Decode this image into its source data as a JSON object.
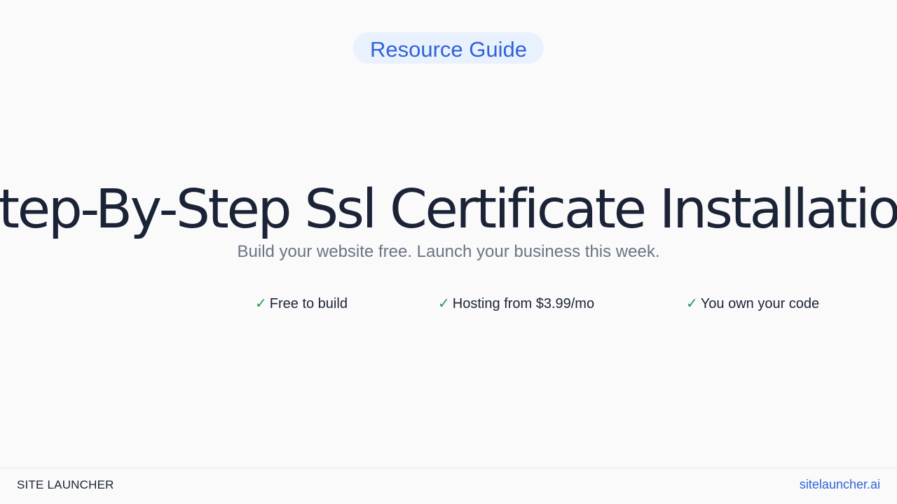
{
  "badge": {
    "label": "Resource Guide"
  },
  "hero": {
    "title": "Step-By-Step Ssl Certificate Installation",
    "subtitle": "Build your website free. Launch your business this week."
  },
  "features": [
    {
      "icon": "check-icon",
      "label": "Free to build"
    },
    {
      "icon": "check-icon",
      "label": "Hosting from $3.99/mo"
    },
    {
      "icon": "check-icon",
      "label": "You own your code"
    }
  ],
  "footer": {
    "brand": "SITE LAUNCHER",
    "link": "sitelauncher.ai"
  },
  "colors": {
    "accent": "#2f63d8",
    "badge_bg": "#eaf1fe",
    "check": "#1e9a4e",
    "text": "#1b2336",
    "muted": "#6b7385",
    "background": "#fafafa"
  }
}
